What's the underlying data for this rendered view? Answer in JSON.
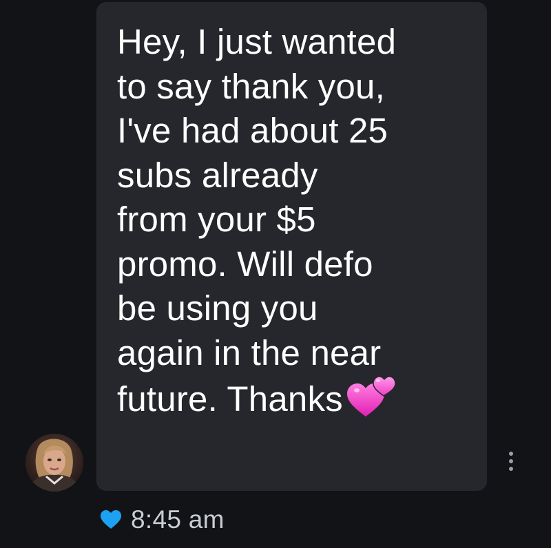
{
  "message": {
    "text": "Hey, I just wanted\nto say thank you,\nI've had about 25\nsubs already\nfrom your $5\npromo. Will defo\nbe using you\nagain in the near\nfuture. Thanks",
    "emoji": "two-hearts-emoji"
  },
  "status": {
    "time": "8:45 am",
    "liked_icon": "heart-icon",
    "liked_color": "#1da1f2"
  },
  "menu_icon": "more-vertical-icon",
  "colors": {
    "background": "#121316",
    "bubble": "#25272c",
    "text": "#ffffff",
    "timestamp": "#c9cdd3"
  }
}
